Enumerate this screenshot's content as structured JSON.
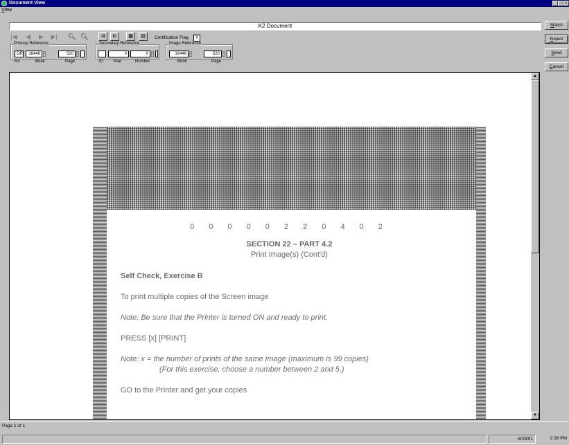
{
  "window": {
    "title": "Document View",
    "controls": {
      "minimize": "_",
      "maximize": "□",
      "close": "×"
    }
  },
  "menu": {
    "items": [
      {
        "accel": "V",
        "rest": "iew"
      }
    ]
  },
  "document_title": "K2 Document",
  "actions": [
    {
      "accel": "M",
      "rest": "atch",
      "pressed": false
    },
    {
      "accel": "R",
      "rest": "eject",
      "pressed": true
    },
    {
      "accel": "S",
      "rest": "end",
      "pressed": false
    },
    {
      "accel": "C",
      "rest": "ancel",
      "pressed": false
    }
  ],
  "toolbar": {
    "icons": {
      "first": "first-page-icon",
      "prev": "previous-page-icon",
      "next": "next-page-icon",
      "last": "last-page-icon",
      "zoom_in": "zoom-in-icon",
      "zoom_out": "zoom-out-icon"
    },
    "certification_flag_label": "Certification Flag",
    "certification_flag_value": "Y"
  },
  "primary_reference": {
    "label": "Primary Reference",
    "src": "OR",
    "book": "16446",
    "page": "520",
    "sublabels": {
      "src": "Src",
      "book": "Book",
      "page": "Page"
    }
  },
  "secondary_reference": {
    "label": "Secondary Reference",
    "id": "",
    "year": "0",
    "number": "0",
    "sublabels": {
      "id": "ID",
      "year": "Year",
      "number": "Number"
    }
  },
  "image_reference": {
    "label": "Image Reference",
    "book": "16446",
    "page": "520",
    "sublabels": {
      "book": "Book",
      "page": "Page"
    }
  },
  "document": {
    "number": "0 0 0 0 0 2 2 0 4 0 2",
    "section": "SECTION 22 – PART 4.2",
    "subtitle": "Print Image(s) (Cont'd)",
    "lines": {
      "self_check": "Self Check, Exercise B",
      "intro": "To print multiple copies of the Screen image",
      "note1": "Note: Be sure that the Printer is turned ON and ready to print.",
      "press": "PRESS [x] [PRINT]",
      "note2a": "Note: x = the number of prints of the same image (maximum is 99 copies)",
      "note2b": "(For this exercise, choose a number between 2 and 5.)",
      "goto": "GO to the Printer and get your copies"
    }
  },
  "status": {
    "page_info": "Page 1 of 1",
    "date": "8/29/01",
    "time": "2:38 PM"
  }
}
